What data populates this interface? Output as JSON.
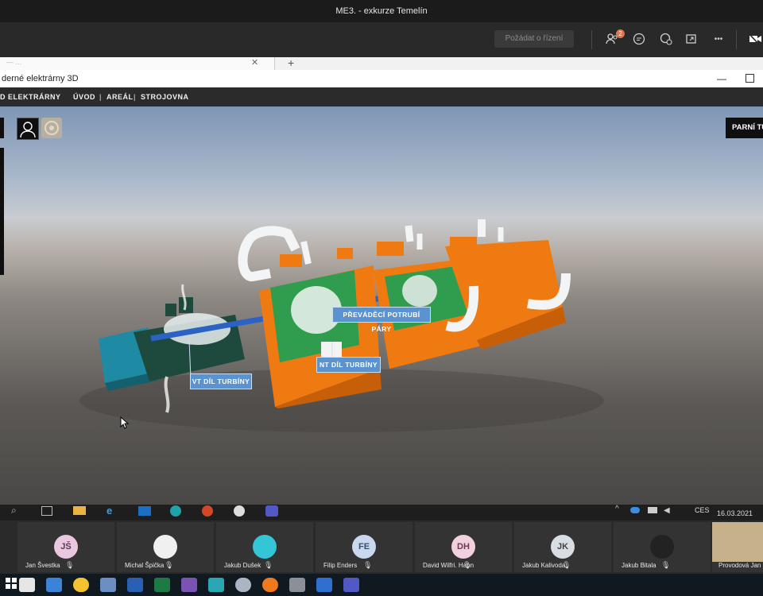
{
  "teams": {
    "window_title": "ME3. - exkurze Temelín",
    "request_control_label": "Požádat o řízení",
    "participants_badge": "2",
    "more_icon": "•••"
  },
  "browser": {
    "tab_text": "— ...",
    "new_tab": "+"
  },
  "app": {
    "window_title": "derné elektrárny 3D",
    "menu": {
      "brand": "D ELEKTRÁRNY",
      "items": [
        "ÚVOD",
        "AREÁL",
        "STROJOVNA"
      ],
      "separator": "|"
    },
    "top_right_button": "PARNÍ TU",
    "labels": {
      "vt": "VT DÍL TURBÍNY",
      "prevadeci": "PŘEVÁDĚCÍ POTRUBÍ PÁRY",
      "nt": "NT DÍL TURBÍNY"
    }
  },
  "tray": {
    "language": "CES",
    "date": "16.03.2021"
  },
  "participants": [
    {
      "initials": "JŠ",
      "name": "Jan Švestka",
      "avatar_color": "#e9c7e0",
      "text_color": "#5b3a57"
    },
    {
      "initials": "",
      "name": "Michal Špička",
      "avatar_color": "#f0f0f0",
      "text_color": "#333"
    },
    {
      "initials": "",
      "name": "Jakub Dušek",
      "avatar_color": "#34c6d6",
      "text_color": "#333"
    },
    {
      "initials": "FE",
      "name": "Filip Enders",
      "avatar_color": "#c9d8ee",
      "text_color": "#3b4d6e"
    },
    {
      "initials": "DH",
      "name": "David Wilfri. Hahn",
      "avatar_color": "#f2d0de",
      "text_color": "#6e3a52"
    },
    {
      "initials": "JK",
      "name": "Jakub Kalivoda",
      "avatar_color": "#d9dde4",
      "text_color": "#444"
    },
    {
      "initials": "",
      "name": "Jakub Bitala",
      "avatar_color": "#222222",
      "text_color": "#fff"
    },
    {
      "initials": "",
      "name": "Provodová Jan",
      "avatar_color": "#c7b18a",
      "text_color": "#333"
    }
  ],
  "colors": {
    "label_blue": "#5a93cf",
    "turbine_orange": "#f07a12",
    "turbine_teal": "#1f8aa3",
    "badge": "#e0734a"
  }
}
